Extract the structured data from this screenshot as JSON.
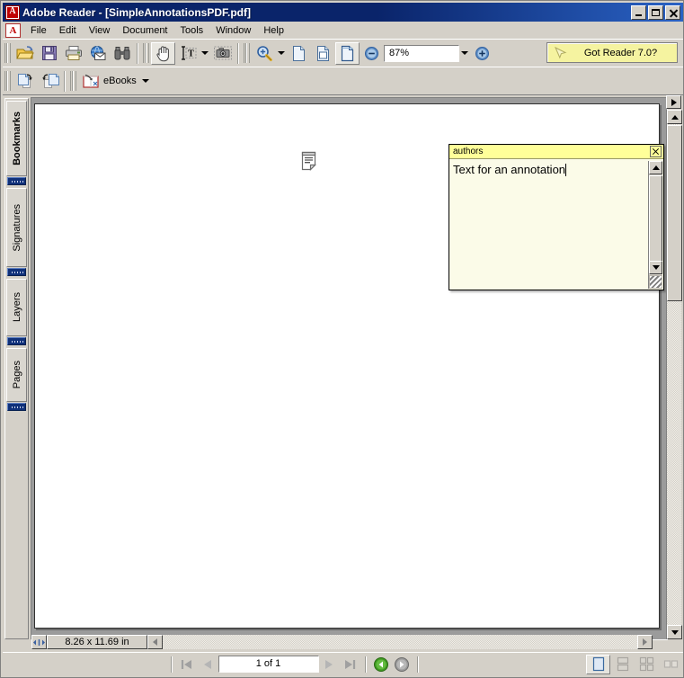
{
  "window": {
    "title": "Adobe Reader - [SimpleAnnotationsPDF.pdf]",
    "app_icon": "adobe-reader-icon",
    "controls": {
      "minimize": "minimize-button",
      "maximize": "maximize-button",
      "close": "close-button"
    }
  },
  "menu": {
    "items": [
      {
        "label": "File"
      },
      {
        "label": "Edit"
      },
      {
        "label": "View"
      },
      {
        "label": "Document"
      },
      {
        "label": "Tools"
      },
      {
        "label": "Window"
      },
      {
        "label": "Help"
      }
    ]
  },
  "toolbar_file": {
    "buttons": [
      {
        "name": "open-button",
        "icon": "open-folder-icon"
      },
      {
        "name": "save-button",
        "icon": "floppy-disk-icon"
      },
      {
        "name": "print-button",
        "icon": "printer-icon"
      },
      {
        "name": "email-button",
        "icon": "globe-envelope-icon"
      },
      {
        "name": "search-button",
        "icon": "binoculars-icon"
      }
    ]
  },
  "toolbar_basic": {
    "buttons": [
      {
        "name": "hand-tool-button",
        "icon": "hand-icon",
        "active": true
      },
      {
        "name": "select-text-button",
        "icon": "text-select-icon",
        "active": false
      },
      {
        "name": "snapshot-button",
        "icon": "camera-icon",
        "active": false
      }
    ]
  },
  "toolbar_zoom": {
    "zoom_tool": {
      "name": "zoom-tool-button",
      "icon": "magnifier-plus-icon"
    },
    "page_views": [
      {
        "name": "actual-size-button",
        "icon": "page-icon",
        "active": false
      },
      {
        "name": "fit-width-button",
        "icon": "page-fit-width-icon",
        "active": false
      },
      {
        "name": "fit-page-button",
        "icon": "page-fit-icon",
        "active": true
      }
    ],
    "zoom_out": {
      "name": "zoom-out-button",
      "icon": "minus-circle-icon"
    },
    "zoom_in": {
      "name": "zoom-in-button",
      "icon": "plus-circle-icon"
    },
    "zoom_value": "87%"
  },
  "toolbar_row2": {
    "buttons": [
      {
        "name": "previous-view-button",
        "icon": "page-forward-icon"
      },
      {
        "name": "next-view-button",
        "icon": "page-back-icon"
      }
    ],
    "ebooks": {
      "label": "eBooks",
      "icon": "ebooks-icon"
    }
  },
  "promo": {
    "label": "Got Reader 7.0?",
    "icon": "cursor-arrow-icon",
    "bg_color": "#f5f3a0"
  },
  "navigation_tabs": {
    "items": [
      {
        "label": "Bookmarks",
        "active": true
      },
      {
        "label": "Signatures",
        "active": false
      },
      {
        "label": "Layers",
        "active": false
      },
      {
        "label": "Pages",
        "active": false
      }
    ]
  },
  "document": {
    "note_annotation": {
      "icon": "sticky-note-icon"
    },
    "popup": {
      "title": "authors",
      "body": "Text for an annotation",
      "close_label": "close-popup",
      "title_bg": "#ffff99",
      "body_bg": "#fbfbe8"
    }
  },
  "status": {
    "page_size": "8.26 x 11.69 in",
    "page_indicator": "1 of 1",
    "nav": {
      "first": "first-page-button",
      "previous": "previous-page-button",
      "next": "next-page-button",
      "last": "last-page-button",
      "back": "previous-view-button",
      "forward": "next-view-button"
    },
    "layout_buttons": [
      {
        "name": "single-page-layout-button",
        "active": true
      },
      {
        "name": "continuous-layout-button",
        "active": false
      },
      {
        "name": "continuous-facing-layout-button",
        "active": false
      },
      {
        "name": "facing-layout-button",
        "active": false
      }
    ]
  }
}
